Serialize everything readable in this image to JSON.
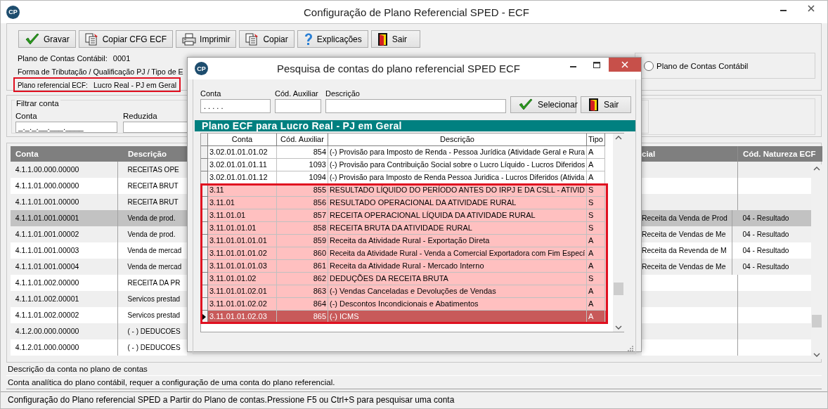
{
  "window": {
    "logo": "CP",
    "title": "Configuração de Plano Referencial SPED - ECF"
  },
  "toolbar": [
    {
      "label": "Gravar",
      "kind": "check"
    },
    {
      "label": "Copiar CFG ECF",
      "kind": "copy"
    },
    {
      "label": "Imprimir",
      "kind": "print"
    },
    {
      "label": "Copiar",
      "kind": "copy"
    },
    {
      "label": "Explicações",
      "kind": "help"
    },
    {
      "label": "Sair",
      "kind": "exit"
    }
  ],
  "info": {
    "plano_contas_label": "Plano de Contas Contábil:",
    "plano_contas_value": "0001",
    "tributacao_label": "Forma de Tributação / Qualificação PJ / Tipo de E",
    "referencial_label": "Plano referencial ECF:",
    "referencial_value": "Lucro Real - PJ em Geral",
    "referencial_outlined": true
  },
  "source_option": {
    "label": "Plano de Contas Contábil",
    "selected": false
  },
  "filter": {
    "title": "Filtrar conta",
    "fields": [
      {
        "label": "Conta",
        "value": "_._._.__.___.____"
      },
      {
        "label": "Reduzida"
      }
    ]
  },
  "table": {
    "columns": [
      "Conta",
      "Descrição",
      "cial",
      "Cód. Natureza ECF"
    ],
    "rows": [
      {
        "cells": [
          "4.1.1.00.000.00000",
          "RECEITAS OPE",
          "",
          ""
        ],
        "selected": false
      },
      {
        "cells": [
          "4.1.1.01.000.00000",
          "RECEITA BRUT",
          "",
          ""
        ],
        "selected": false
      },
      {
        "cells": [
          "4.1.1.01.001.00000",
          "RECEITA BRUT",
          "",
          ""
        ],
        "selected": false
      },
      {
        "cells": [
          "4.1.1.01.001.00001",
          "Venda de prod.",
          "Receita da Venda de Prod",
          "04 - Resultado"
        ],
        "selected": true
      },
      {
        "cells": [
          "4.1.1.01.001.00002",
          "Venda de prod.",
          "Receita de Vendas de Me",
          "04 - Resultado"
        ],
        "selected": false
      },
      {
        "cells": [
          "4.1.1.01.001.00003",
          "Venda de mercad",
          "Receita da Revenda de M",
          "04 - Resultado"
        ],
        "selected": false
      },
      {
        "cells": [
          "4.1.1.01.001.00004",
          "Venda de mercad",
          "Receita de Vendas de Me",
          "04 - Resultado"
        ],
        "selected": false
      },
      {
        "cells": [
          "4.1.1.01.002.00000",
          "RECEITA DA PR",
          "",
          ""
        ],
        "selected": false
      },
      {
        "cells": [
          "4.1.1.01.002.00001",
          "Servicos prestad",
          "",
          ""
        ],
        "selected": false
      },
      {
        "cells": [
          "4.1.1.01.002.00002",
          "Servicos prestad",
          "",
          ""
        ],
        "selected": false
      },
      {
        "cells": [
          "4.1.2.00.000.00000",
          "( - ) DEDUCOES",
          "",
          ""
        ],
        "selected": false
      },
      {
        "cells": [
          "4.1.2.01.000.00000",
          "( - ) DEDUCOES",
          "",
          ""
        ],
        "selected": false
      }
    ]
  },
  "status": [
    "Descrição da conta no plano de contas",
    "Conta analítica do plano contábil, requer a configuração de uma conta do plano referencial."
  ],
  "status_bar": "Configuração do Plano referencial SPED a Partir do Plano de contas.Pressione F5 ou Ctrl+S para pesquisar uma conta",
  "dialog": {
    "logo": "CP",
    "title": "Pesquisa de contas do plano referencial SPED ECF",
    "fields": [
      {
        "label": "Conta",
        "value": ". . . . ."
      },
      {
        "label": "Cód. Auxiliar"
      },
      {
        "label": "Descrição"
      }
    ],
    "buttons": [
      {
        "label": "Selecionar",
        "kind": "check"
      },
      {
        "label": "Sair",
        "kind": "exit"
      }
    ],
    "grid_title": "Plano ECF para Lucro Real - PJ em Geral",
    "columns": [
      "Conta",
      "Cód. Auxiliar",
      "Descrição",
      "Tipo"
    ],
    "rows": [
      {
        "cells": [
          "3.02.01.01.01.02",
          "854",
          "(-) Provisão para Imposto de Renda - Pessoa Jurídica (Atividade Geral e Rura",
          "A"
        ],
        "highlighted": false,
        "selected": false
      },
      {
        "cells": [
          "3.02.01.01.01.11",
          "1093",
          "(-) Provisão para Contribuição Social sobre o Lucro Líquido - Lucros Diferidos",
          "A"
        ],
        "highlighted": false,
        "selected": false
      },
      {
        "cells": [
          "3.02.01.01.01.12",
          "1094",
          "(-) Provisão para Imposto de Renda Pessoa Juridica - Lucros Diferidos (Ativida",
          "A"
        ],
        "highlighted": false,
        "selected": false
      },
      {
        "cells": [
          "3.11",
          "855",
          "RESULTADO LÍQUIDO DO PERÍODO ANTES DO IRPJ E DA CSLL - ATIVID",
          "S"
        ],
        "highlighted": true,
        "selected": false
      },
      {
        "cells": [
          "3.11.01",
          "856",
          "RESULTADO OPERACIONAL DA ATIVIDADE RURAL",
          "S"
        ],
        "highlighted": true,
        "selected": false
      },
      {
        "cells": [
          "3.11.01.01",
          "857",
          "RECEITA OPERACIONAL LÍQUIDA DA ATIVIDADE RURAL",
          "S"
        ],
        "highlighted": true,
        "selected": false
      },
      {
        "cells": [
          "3.11.01.01.01",
          "858",
          "RECEITA BRUTA DA ATIVIDADE RURAL",
          "S"
        ],
        "highlighted": true,
        "selected": false
      },
      {
        "cells": [
          "3.11.01.01.01.01",
          "859",
          "Receita da Atividade Rural - Exportação Direta",
          "A"
        ],
        "highlighted": true,
        "selected": false
      },
      {
        "cells": [
          "3.11.01.01.01.02",
          "860",
          "Receita da Atividade Rural - Venda a Comercial Exportadora com Fim Especí",
          "A"
        ],
        "highlighted": true,
        "selected": false
      },
      {
        "cells": [
          "3.11.01.01.01.03",
          "861",
          "Receita da Atividade Rural - Mercado Interno",
          "A"
        ],
        "highlighted": true,
        "selected": false
      },
      {
        "cells": [
          "3.11.01.01.02",
          "862",
          "DEDUÇÕES DA RECEITA BRUTA",
          "S"
        ],
        "highlighted": true,
        "selected": false
      },
      {
        "cells": [
          "3.11.01.01.02.01",
          "863",
          "(-) Vendas Canceladas e Devoluções de Vendas",
          "A"
        ],
        "highlighted": true,
        "selected": false
      },
      {
        "cells": [
          "3.11.01.01.02.02",
          "864",
          "(-) Descontos Incondicionais e Abatimentos",
          "A"
        ],
        "highlighted": true,
        "selected": false
      },
      {
        "cells": [
          "3.11.01.01.02.03",
          "865",
          "(-) ICMS",
          "A"
        ],
        "highlighted": true,
        "selected": true
      }
    ]
  }
}
